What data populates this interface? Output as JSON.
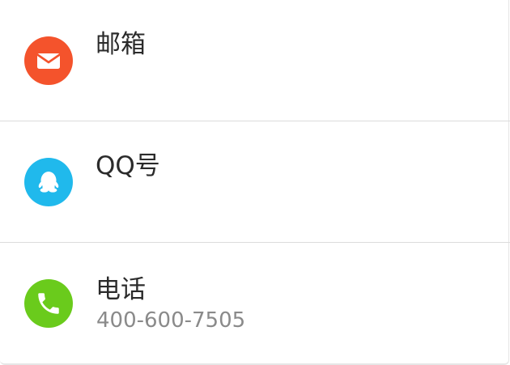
{
  "contacts": [
    {
      "icon": "mail-icon",
      "color": "#F4532C",
      "title": "邮箱",
      "subtitle": ""
    },
    {
      "icon": "qq-icon",
      "color": "#20B9EC",
      "title": "QQ号",
      "subtitle": ""
    },
    {
      "icon": "phone-icon",
      "color": "#6ACB1C",
      "title": "电话",
      "subtitle": "400-600-7505"
    }
  ]
}
